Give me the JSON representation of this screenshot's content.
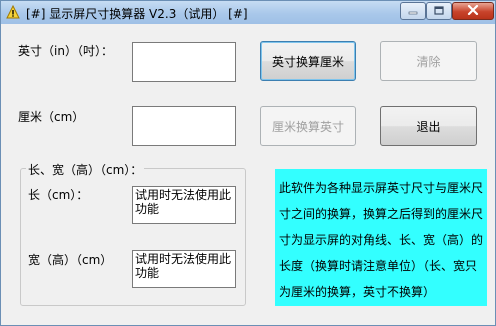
{
  "window": {
    "title": "[#] 显示屏尺寸换算器 V2.3（试用） [#]"
  },
  "form": {
    "inch_label": "英寸（in）（吋）：",
    "cm_label": "厘米（cm）",
    "inch_value": "",
    "cm_value": "",
    "group_title": "长、宽（高）（cm）：",
    "length_label": "长（cm）：",
    "width_label": "宽（高）（cm）",
    "length_value": "试用时无法使用此功能",
    "width_value": "试用时无法使用此功能"
  },
  "buttons": {
    "inch_to_cm": "英寸换算厘米",
    "clear": "清除",
    "cm_to_inch": "厘米换算英寸",
    "exit": "退出"
  },
  "info": {
    "text": "此软件为各种显示屏英寸尺寸与厘米尺寸之间的换算，换算之后得到的厘米尺寸为显示屏的对角线、长、宽（高）的长度（换算时请注意单位）（长、宽只为厘米的换算，英寸不换算）"
  },
  "colors": {
    "info_background": "#33ffff",
    "titlebar": "#a9c8ea",
    "close_button": "#c8432b"
  },
  "icons": {
    "app": "warning-triangle-icon",
    "minimize": "minimize-icon",
    "maximize": "maximize-icon",
    "close": "close-icon"
  }
}
